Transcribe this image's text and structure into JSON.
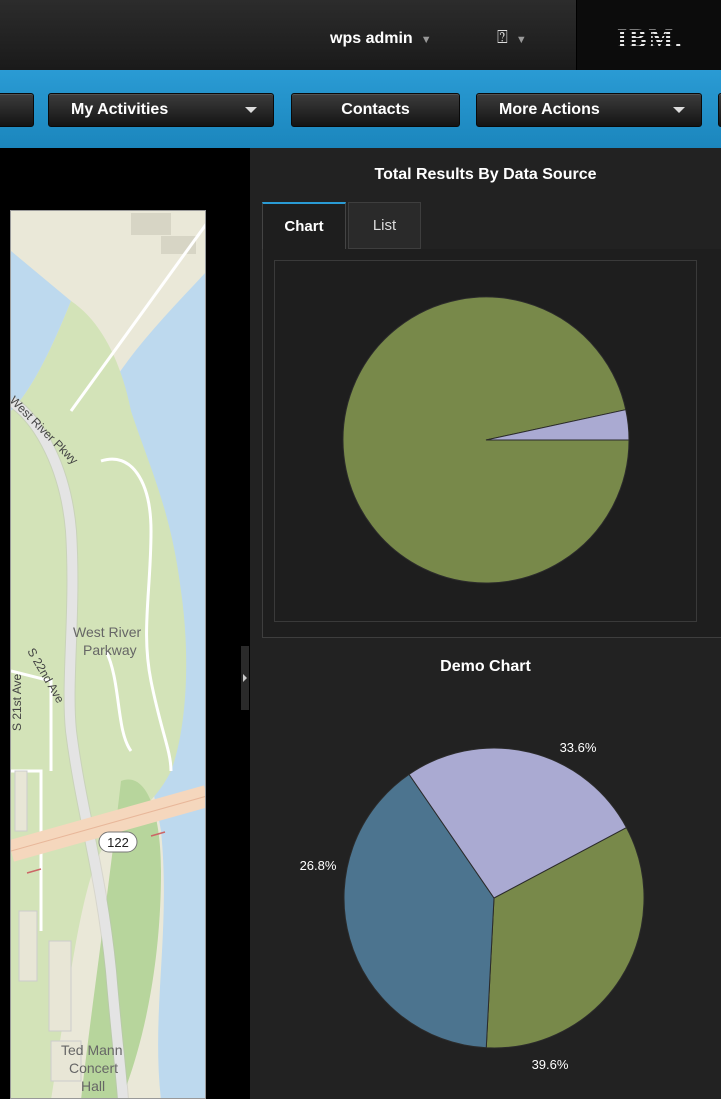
{
  "header": {
    "user_label": "wps admin",
    "help_label": "?",
    "logo_text": "IBM."
  },
  "nav": {
    "my_activities": "My Activities",
    "contacts": "Contacts",
    "more_actions": "More Actions"
  },
  "map": {
    "labels": {
      "river_pkwy_upper": "West River Pkwy",
      "west_river": "West River",
      "parkway": "Parkway",
      "s22": "S 22nd Ave",
      "s21": "S 21st Ave",
      "route": "122",
      "ted_mann": "Ted Mann",
      "concert": "Concert",
      "hall": "Hall"
    }
  },
  "results_panel": {
    "title": "Total Results By Data Source",
    "tabs": [
      "Chart",
      "List"
    ]
  },
  "demo_panel": {
    "title": "Demo Chart"
  },
  "colors": {
    "olive": "#78894a",
    "lavender": "#aaaad2",
    "steel": "#4c748f",
    "nav_blue": "#2a9bd4"
  },
  "chart_data": [
    {
      "type": "pie",
      "title": "Total Results By Data Source",
      "values": [
        96.6,
        3.4
      ],
      "colors": [
        "#78894a",
        "#aaaad2"
      ]
    },
    {
      "type": "pie",
      "title": "Demo Chart",
      "values": [
        33.6,
        39.6,
        26.8
      ],
      "labels": [
        "33.6%",
        "39.6%",
        "26.8%"
      ],
      "colors": [
        "#78894a",
        "#4c748f",
        "#aaaad2"
      ]
    }
  ]
}
